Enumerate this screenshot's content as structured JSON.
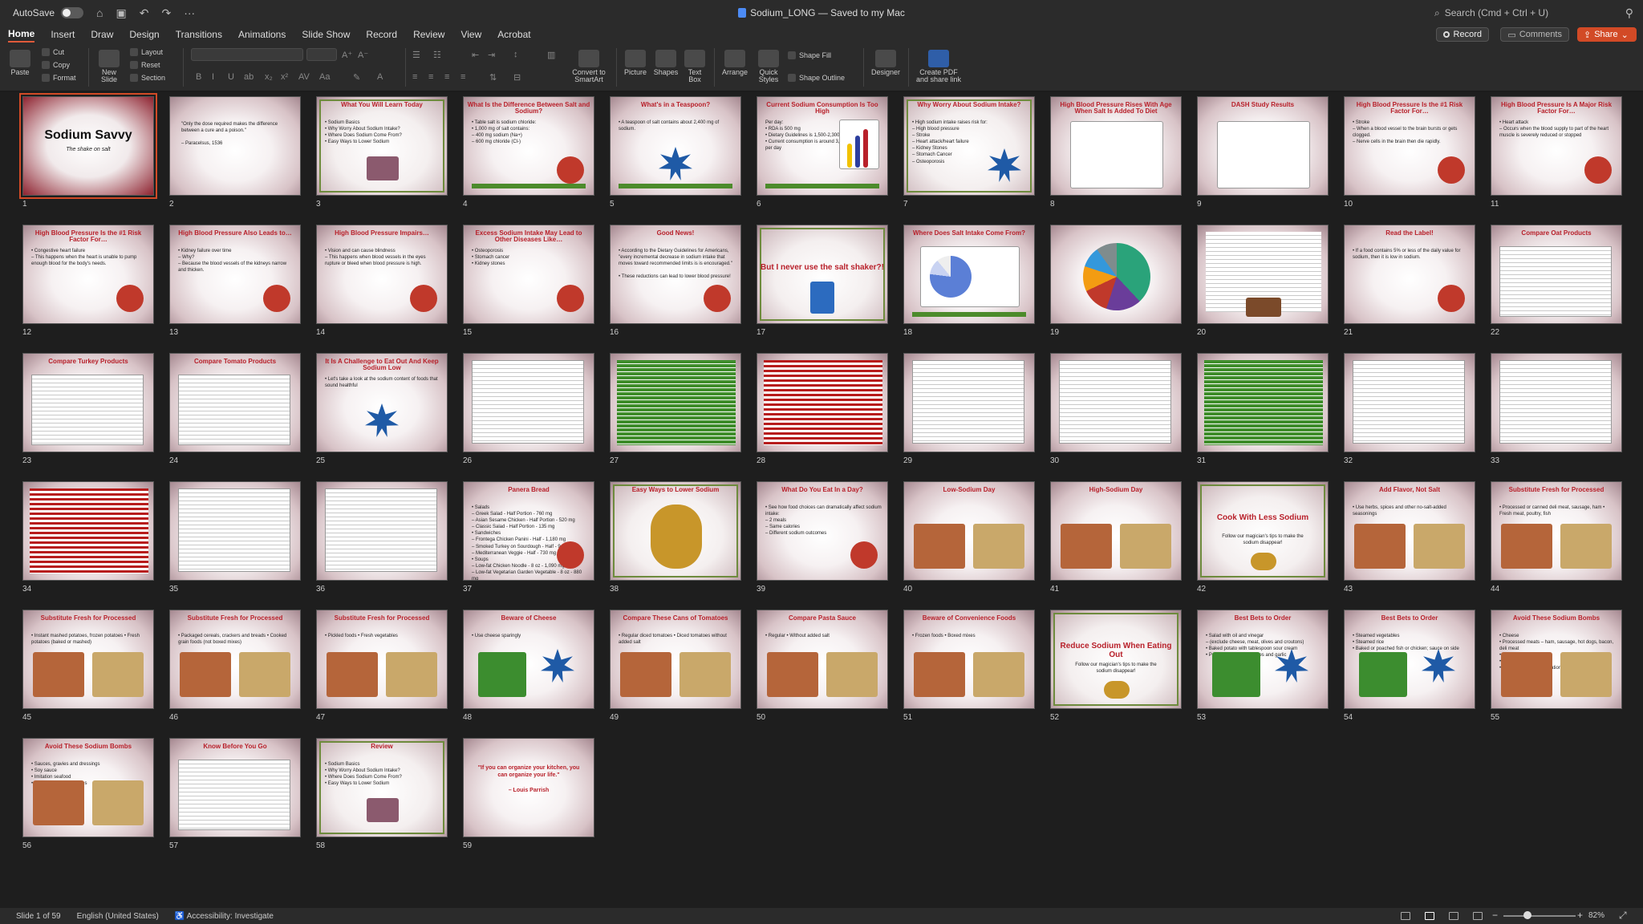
{
  "titlebar": {
    "autosave_label": "AutoSave",
    "doc_title": "Sodium_LONG — Saved to my Mac",
    "search_placeholder": "Search (Cmd + Ctrl + U)"
  },
  "menu": {
    "tabs": [
      "Home",
      "Insert",
      "Draw",
      "Design",
      "Transitions",
      "Animations",
      "Slide Show",
      "Record",
      "Review",
      "View",
      "Acrobat"
    ],
    "active": "Home"
  },
  "topbuttons": {
    "record": "Record",
    "comments": "Comments",
    "share": "Share"
  },
  "ribbon": {
    "paste": "Paste",
    "cut": "Cut",
    "copy": "Copy",
    "format": "Format",
    "new_slide": "New\nSlide",
    "layout": "Layout",
    "reset": "Reset",
    "section": "Section",
    "convert_smartart": "Convert to\nSmartArt",
    "picture": "Picture",
    "shapes": "Shapes",
    "text_box": "Text\nBox",
    "arrange": "Arrange",
    "quick_styles": "Quick\nStyles",
    "shape_fill": "Shape Fill",
    "shape_outline": "Shape Outline",
    "designer": "Designer",
    "create_pdf": "Create PDF\nand share link"
  },
  "slides": [
    {
      "n": 1,
      "title": "Sodium Savvy",
      "sub": "The shake on salt",
      "kind": "cover"
    },
    {
      "n": 2,
      "quote": "\"Only the dose required makes the difference between a cure and a poison.\"\n\n– Paracelsus, 1536",
      "kind": "quote"
    },
    {
      "n": 3,
      "title": "What You Will Learn Today",
      "body": "• Sodium Basics\n• Why Worry About Sodium Intake?\n• Where Does Sodium Come From?\n• Easy Ways to Lower Sodium",
      "kind": "framed"
    },
    {
      "n": 4,
      "title": "What Is the Difference Between Salt and Sodium?",
      "body": "• Table salt is sodium chloride:\n• 1,000 mg of salt contains:\n   – 400 mg sodium (Na+)\n   – 600 mg chloride (Cl-)",
      "kind": "text"
    },
    {
      "n": 5,
      "title": "What's in a Teaspoon?",
      "body": "• A teaspoon of salt contains about 2,400 mg of sodium.",
      "kind": "star"
    },
    {
      "n": 6,
      "title": "Current Sodium Consumption Is Too High",
      "body": "Per day:\n• RDA is 500 mg\n• Dietary Guidelines is 1,500-2,300 mg\n• Current consumption is around 3,400 to 4,200 mg per day",
      "kind": "chart"
    },
    {
      "n": 7,
      "title": "Why Worry About Sodium Intake?",
      "body": "• High sodium intake raises risk for:\n  – High blood pressure\n  – Stroke\n  – Heart attack/heart failure\n  – Kidney Stones\n  – Stomach Cancer\n  – Osteoporosis",
      "kind": "framedstar"
    },
    {
      "n": 8,
      "title": "High Blood Pressure Rises With Age When Salt Is Added To Diet",
      "kind": "graph"
    },
    {
      "n": 9,
      "title": "DASH Study Results",
      "kind": "graph"
    },
    {
      "n": 10,
      "title": "High Blood Pressure Is the #1 Risk Factor For…",
      "body": "• Stroke\n  – When a blood vessel to the brain bursts or gets clogged.\n  – Nerve cells in the brain then die rapidly.",
      "kind": "text"
    },
    {
      "n": 11,
      "title": "High Blood Pressure Is A Major Risk Factor For…",
      "body": "• Heart attack\n  – Occurs when the blood supply to part of the heart muscle is severely reduced or stopped",
      "kind": "text"
    },
    {
      "n": 12,
      "title": "High Blood Pressure Is the #1 Risk Factor For…",
      "body": "• Congestive heart failure\n  – This happens when the heart is unable to pump enough blood for the body's needs.",
      "kind": "text"
    },
    {
      "n": 13,
      "title": "High Blood Pressure Also Leads to…",
      "body": "• Kidney failure over time\n  – Why?\n  – Because the blood vessels of the kidneys narrow and thicken.",
      "kind": "text"
    },
    {
      "n": 14,
      "title": "High Blood Pressure Impairs…",
      "body": "• Vision and can cause blindness\n  – This happens when blood vessels in the eyes rupture or bleed when blood pressure is high.",
      "kind": "text"
    },
    {
      "n": 15,
      "title": "Excess Sodium Intake May Lead to Other Diseases Like…",
      "body": "• Osteoporosis\n• Stomach cancer\n• Kidney stones",
      "kind": "text"
    },
    {
      "n": 16,
      "title": "Good News!",
      "body": "• According to the Dietary Guidelines for Americans, \"every incremental decrease in sodium intake that moves toward recommended limits is is encouraged.\"\n\n• These reductions can lead to lower blood pressure!",
      "kind": "text"
    },
    {
      "n": 17,
      "title": "But I never use the salt shaker?!",
      "kind": "framedbig"
    },
    {
      "n": 18,
      "title": "Where Does Salt Intake Come From?",
      "kind": "pie"
    },
    {
      "n": 19,
      "kind": "pie2"
    },
    {
      "n": 20,
      "kind": "doc"
    },
    {
      "n": 21,
      "title": "Read the Label!",
      "body": "• If a food contains 5% or less of the daily value for sodium, then it is low in sodium.",
      "kind": "text"
    },
    {
      "n": 22,
      "title": "Compare Oat Products",
      "kind": "table"
    },
    {
      "n": 23,
      "title": "Compare Turkey Products",
      "kind": "table"
    },
    {
      "n": 24,
      "title": "Compare Tomato Products",
      "kind": "table"
    },
    {
      "n": 25,
      "title": "It Is A Challenge to Eat Out And Keep Sodium Low",
      "body": "• Let's take a look at the sodium content of foods that sound healthful",
      "kind": "star"
    },
    {
      "n": 26,
      "kind": "table"
    },
    {
      "n": 27,
      "kind": "greentable"
    },
    {
      "n": 28,
      "kind": "redtable"
    },
    {
      "n": 29,
      "kind": "table"
    },
    {
      "n": 30,
      "kind": "table"
    },
    {
      "n": 31,
      "kind": "greentable"
    },
    {
      "n": 32,
      "kind": "table"
    },
    {
      "n": 33,
      "kind": "table"
    },
    {
      "n": 34,
      "kind": "redtable"
    },
    {
      "n": 35,
      "kind": "table"
    },
    {
      "n": 36,
      "kind": "table"
    },
    {
      "n": 37,
      "title": "Panera Bread",
      "body": "• Salads\n  – Greek Salad - Half Portion - 760 mg\n  – Asian Sesame Chicken - Half Portion - 520 mg\n  – Classic Salad - Half Portion - 135 mg\n• Sandwiches\n  – Frontega Chicken Panini - Half - 1,180 mg\n  – Smoked Turkey on Sourdough - Half - 940 mg\n  – Mediterranean Veggie - Half - 730 mg\n• Soups\n  – Low-fat Chicken Noodle - 8 oz - 1,090 mg\n  – Low-fat Vegetarian Garden Vegetable - 8 oz - 880 mg",
      "kind": "text"
    },
    {
      "n": 38,
      "title": "Easy Ways to Lower Sodium",
      "kind": "framedimg"
    },
    {
      "n": 39,
      "title": "What Do You Eat In a Day?",
      "body": "• See how food choices can dramatically affect sodium intake:\n  – 2 meals\n  – Same calories\n  – Different sodium outcomes",
      "kind": "text"
    },
    {
      "n": 40,
      "title": "Low-Sodium Day",
      "kind": "food"
    },
    {
      "n": 41,
      "title": "High-Sodium Day",
      "kind": "food"
    },
    {
      "n": 42,
      "title": "Cook With Less Sodium",
      "body": "Follow our magician's tips to make the sodium disappear!",
      "kind": "framedcenter"
    },
    {
      "n": 43,
      "title": "Add Flavor, Not Salt",
      "body": "• Use herbs, spices and other no-salt-added seasonings",
      "kind": "food"
    },
    {
      "n": 44,
      "title": "Substitute Fresh for Processed",
      "body": "• Processed or canned deli meat, sausage, ham      • Fresh meat, poultry, fish",
      "kind": "food"
    },
    {
      "n": 45,
      "title": "Substitute Fresh for Processed",
      "body": "• Instant mashed potatoes, frozen potatoes      • Fresh potatoes (baked or mashed)",
      "kind": "food"
    },
    {
      "n": 46,
      "title": "Substitute Fresh for Processed",
      "body": "• Packaged cereals, crackers and breads      • Cooked grain foods (not boxed mixes)",
      "kind": "food"
    },
    {
      "n": 47,
      "title": "Substitute Fresh for Processed",
      "body": "• Pickled foods      • Fresh vegetables",
      "kind": "food"
    },
    {
      "n": 48,
      "title": "Beware of Cheese",
      "body": "• Use cheese sparingly",
      "kind": "foodstar"
    },
    {
      "n": 49,
      "title": "Compare These Cans of Tomatoes",
      "body": "• Regular diced tomatoes      • Diced tomatoes without added salt",
      "kind": "food"
    },
    {
      "n": 50,
      "title": "Compare Pasta Sauce",
      "body": "• Regular      • Without added salt",
      "kind": "food"
    },
    {
      "n": 51,
      "title": "Beware of Convenience Foods",
      "body": "• Frozen foods      • Boxed mixes",
      "kind": "food"
    },
    {
      "n": 52,
      "title": "Reduce Sodium When Eating Out",
      "body": "Follow our magician's tips to make the sodium disappear!",
      "kind": "framedcenter"
    },
    {
      "n": 53,
      "title": "Best Bets to Order",
      "body": "• Salad with oil and vinegar\n  – (exclude cheese, meat, olives and croutons)\n• Baked potato with tablespoon sour cream\n• Pasta with fresh tomatoes and garlic",
      "kind": "foodstar"
    },
    {
      "n": 54,
      "title": "Best Bets to Order",
      "body": "• Steamed vegetables\n• Steamed rice\n• Baked or poached fish or chicken; sauce on side",
      "kind": "foodstar"
    },
    {
      "n": 55,
      "title": "Avoid These Sodium Bombs",
      "body": "• Cheese\n• Processed meats – ham, sausage, hot dogs, bacon, deli meat\n• Fried foods\n• Bread\n• Many Asian foods (imitation seafood, sauces)",
      "kind": "food"
    },
    {
      "n": 56,
      "title": "Avoid These Sodium Bombs",
      "body": "• Sauces, gravies and dressings\n• Soy sauce\n• Imitation seafood\n• Instant mashed potatoes",
      "kind": "food"
    },
    {
      "n": 57,
      "title": "Know Before You Go",
      "kind": "table"
    },
    {
      "n": 58,
      "title": "Review",
      "body": "• Sodium Basics\n• Why Worry About Sodium Intake?\n• Where Does Sodium Come From?\n• Easy Ways to Lower Sodium",
      "kind": "framed"
    },
    {
      "n": 59,
      "quote": "\"If you can organize your kitchen, you can organize your life.\"\n\n– Louis Parrish",
      "kind": "quotered"
    }
  ],
  "status": {
    "slide_count": "Slide 1 of 59",
    "language": "English (United States)",
    "accessibility": "Accessibility: Investigate",
    "zoom": "82%"
  },
  "colors": {
    "accent": "#d24a26",
    "title_red": "#b8202a",
    "frame_green": "#6e8b3d",
    "star_blue": "#1f5aa6"
  }
}
